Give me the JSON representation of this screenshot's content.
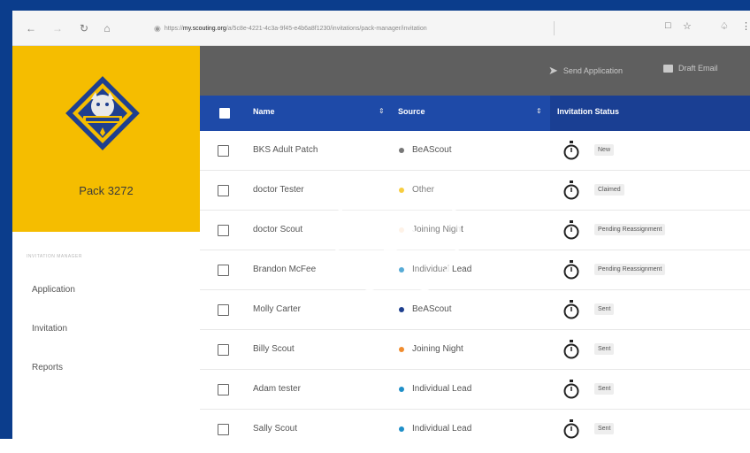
{
  "browser": {
    "back_icon": "back-arrow-icon",
    "url_prefix": "https://",
    "url_domain": "my.scouting.org",
    "url_path": "/a/5c8e-4221-4c3a-9f45-e4b6a8f1230/invitations/pack-manager/invitation",
    "bookmark_icon": "star-icon"
  },
  "sidebar": {
    "pack_name": "Pack 3272",
    "caption": "INVITATION MANAGER",
    "items": [
      {
        "label": "Application"
      },
      {
        "label": "Invitation"
      },
      {
        "label": "Reports"
      }
    ]
  },
  "toolbar": {
    "send_label": "Send Application",
    "email_label": "Draft Email"
  },
  "table": {
    "headers": {
      "name": "Name",
      "source": "Source",
      "status": "Invitation Status"
    },
    "rows": [
      {
        "name": "BKS Adult Patch",
        "source": "BeAScout",
        "source_color": "#777777",
        "status": "New"
      },
      {
        "name": "doctor Tester",
        "source": "Other",
        "source_color": "#f5bd00",
        "status": "Claimed"
      },
      {
        "name": "doctor Scout",
        "source": "Joining Night",
        "source_color": "#f08c2e",
        "status": "Pending Reassignment"
      },
      {
        "name": "Brandon McFee",
        "source": "Individual Lead",
        "source_color": "#1f8fc8",
        "status": "Pending Reassignment"
      },
      {
        "name": "Molly Carter",
        "source": "BeAScout",
        "source_color": "#1e3f8e",
        "status": "Sent"
      },
      {
        "name": "Billy Scout",
        "source": "Joining Night",
        "source_color": "#f08c2e",
        "status": "Sent"
      },
      {
        "name": "Adam tester",
        "source": "Individual Lead",
        "source_color": "#1f8fc8",
        "status": "Sent"
      },
      {
        "name": "Sally Scout",
        "source": "Individual Lead",
        "source_color": "#1f8fc8",
        "status": "Sent"
      }
    ]
  },
  "colors": {
    "brand_yellow": "#f5bd00",
    "header_blue": "#1e4aa8",
    "toolbar_gray": "#5f5f5f",
    "frame_blue": "#0b3d8c"
  }
}
